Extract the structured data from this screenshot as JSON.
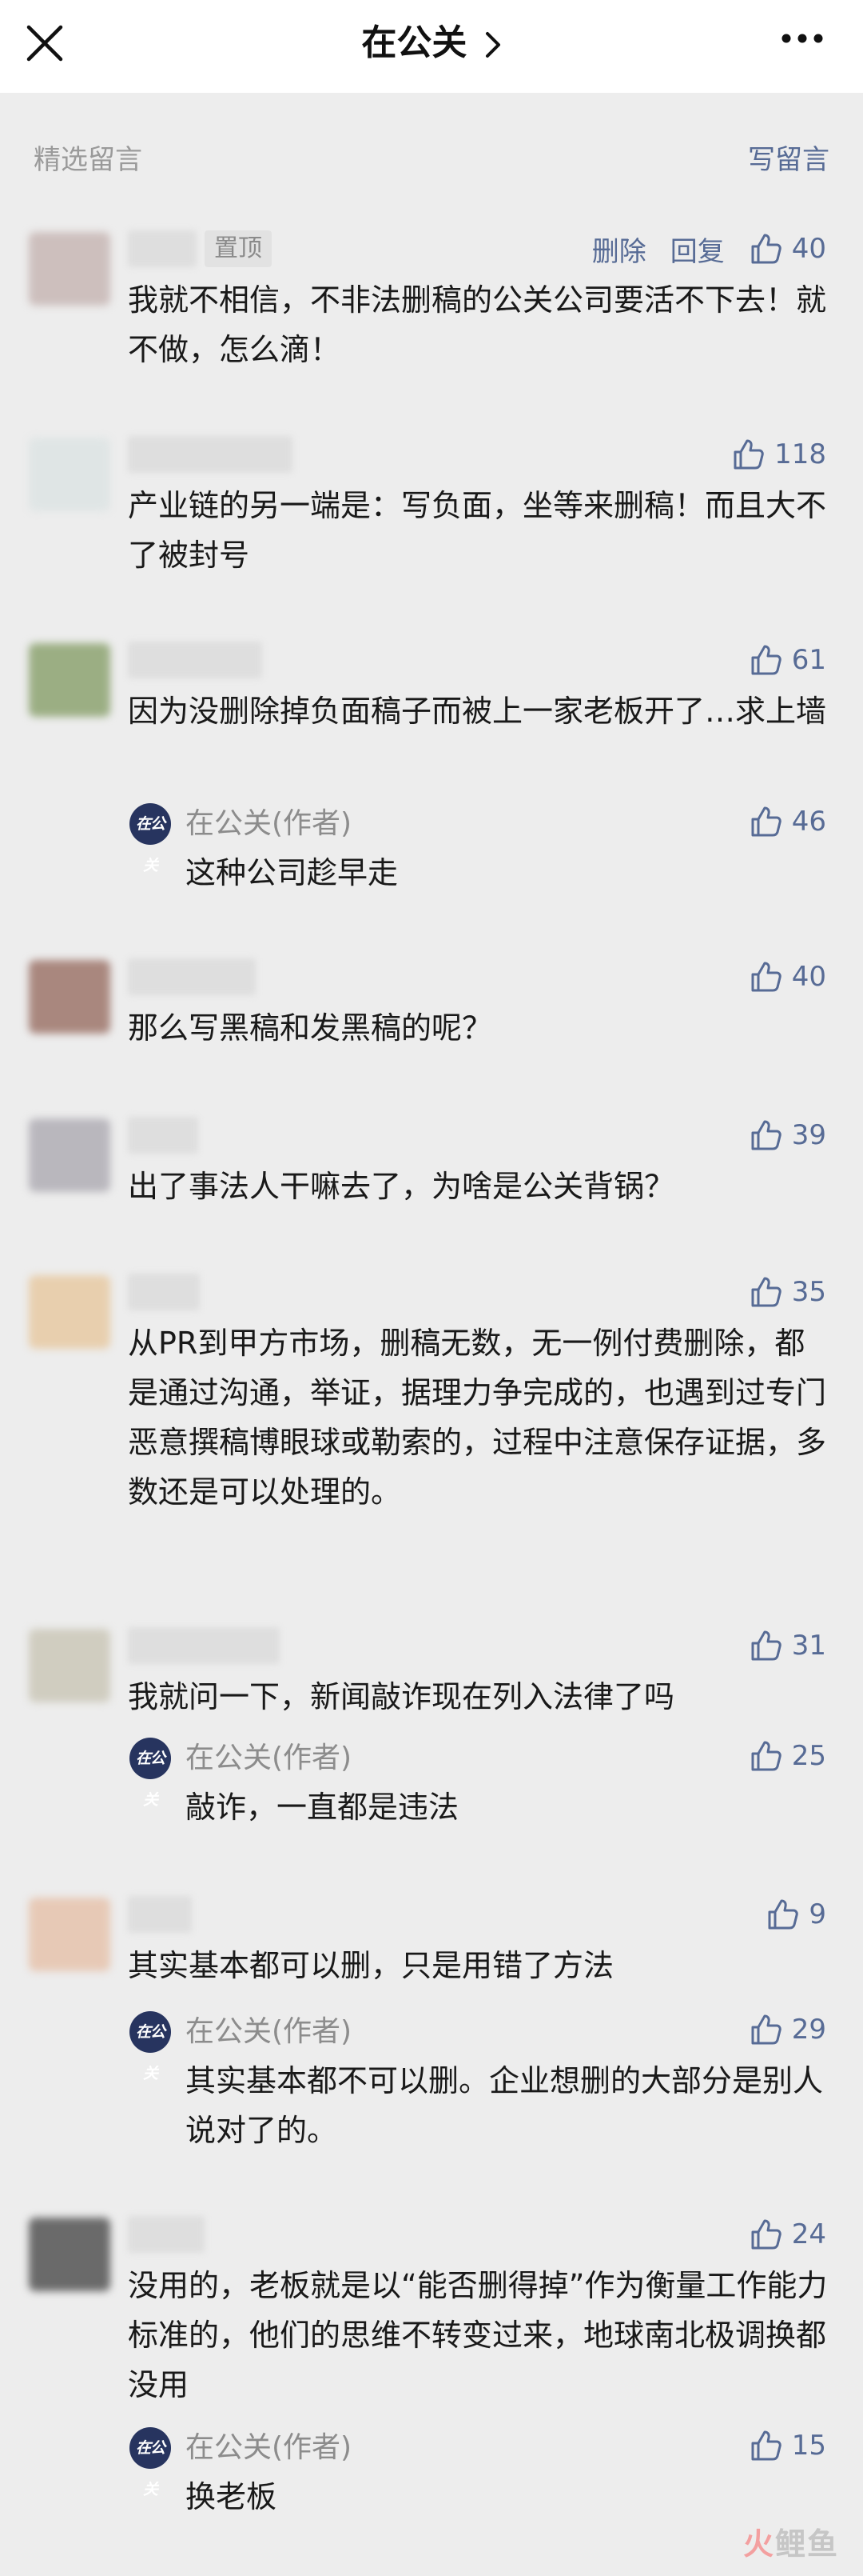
{
  "header": {
    "title": "在公关",
    "close_icon": "close-icon",
    "more_icon": "more-horizontal-icon"
  },
  "section": {
    "label": "精选留言",
    "write": "写留言"
  },
  "comments": [
    {
      "pinned": "置顶",
      "delete": "删除",
      "reply": "回复",
      "likes": "40",
      "text": "我就不相信，不非法删稿的公关公司要活不下去！就不做，怎么滴！"
    },
    {
      "likes": "118",
      "text": "产业链的另一端是：写负面，坐等来删稿！而且大不了被封号"
    },
    {
      "likes": "61",
      "text": "因为没删除掉负面稿子而被上一家老板开了…求上墙",
      "reply": {
        "author": "在公关(作者)",
        "likes": "46",
        "text": "这种公司趁早走"
      }
    },
    {
      "likes": "40",
      "text": "那么写黑稿和发黑稿的呢？"
    },
    {
      "likes": "39",
      "text": "出了事法人干嘛去了，为啥是公关背锅？"
    },
    {
      "likes": "35",
      "text": "从PR到甲方市场，删稿无数，无一例付费删除，都是通过沟通，举证，据理力争完成的，也遇到过专门恶意撰稿博眼球或勒索的，过程中注意保存证据，多数还是可以处理的。"
    },
    {
      "likes": "31",
      "text": "我就问一下，新闻敲诈现在列入法律了吗",
      "reply": {
        "author": "在公关(作者)",
        "likes": "25",
        "text": "敲诈，一直都是违法"
      }
    },
    {
      "likes": "9",
      "text": "其实基本都可以删，只是用错了方法",
      "reply": {
        "author": "在公关(作者)",
        "likes": "29",
        "text": "其实基本都不可以删。企业想删的大部分是别人说对了的。"
      }
    },
    {
      "likes": "24",
      "text": "没用的，老板就是以“能否删得掉”作为衡量工作能力标准的，他们的思维不转变过来，地球南北极调换都没用",
      "reply": {
        "author": "在公关(作者)",
        "likes": "15",
        "text": "换老板"
      }
    }
  ],
  "author_badge": "在公关",
  "watermark": {
    "red": "火",
    "rest": "鲤鱼"
  },
  "colors": {
    "link": "#576b95",
    "background": "#ededed",
    "badge": "#27345f"
  }
}
